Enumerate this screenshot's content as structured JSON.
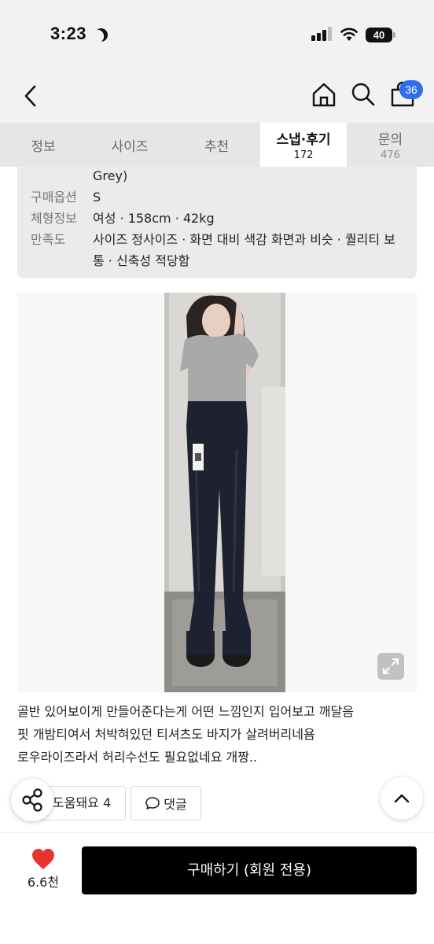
{
  "status_bar": {
    "time": "3:23",
    "battery": "40"
  },
  "nav": {
    "cart_count": "36"
  },
  "tabs": [
    {
      "label": "정보",
      "count": ""
    },
    {
      "label": "사이즈",
      "count": ""
    },
    {
      "label": "추천",
      "count": ""
    },
    {
      "label": "스냅·후기",
      "count": "172"
    },
    {
      "label": "문의",
      "count": "476"
    }
  ],
  "active_tab": "스냅·후기",
  "review_info": {
    "color_cont": "Grey)",
    "option_label": "구매옵션",
    "option_value": "S",
    "body_label": "체형정보",
    "body_value": "여성 · 158cm · 42kg",
    "satisfaction_label": "만족도",
    "satisfaction_value": "사이즈 정사이즈 · 화면 대비 색감 화면과 비슷 · 퀄리티 보통 · 신축성 적당함"
  },
  "review": {
    "lines": [
      "골반 있어보이게 만들어준다는게 어떤 느낌인지 입어보고 깨달음",
      "핏 개밤티여서 처박혀있던 티셔츠도 바지가 살려버리네욤",
      "로우라이즈라서 허리수선도 필요없네요 개짱.."
    ]
  },
  "actions": {
    "helpful_label": "도움돼요 4",
    "comment_label": "댓글"
  },
  "bottom": {
    "likes": "6.6천",
    "buy_label": "구매하기 (회원 전용)"
  },
  "colors": {
    "accent": "#2f6fed",
    "heart": "#e8332e",
    "buy_bg": "#000000"
  }
}
